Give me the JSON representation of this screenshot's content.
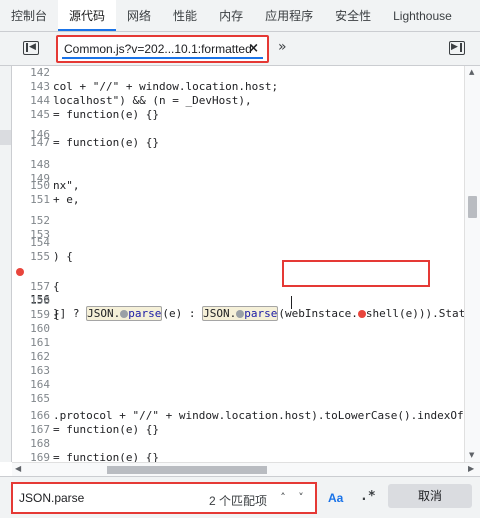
{
  "topbar": {
    "tabs": [
      {
        "label": "控制台"
      },
      {
        "label": "源代码"
      },
      {
        "label": "网络"
      },
      {
        "label": "性能"
      },
      {
        "label": "内存"
      },
      {
        "label": "应用程序"
      },
      {
        "label": "安全性"
      },
      {
        "label": "Lighthouse"
      }
    ],
    "active_index": 1
  },
  "file_tab": {
    "name": "Common.js?v=202...10.1:formatted",
    "close": "×",
    "more_tabs": "»"
  },
  "code": {
    "lines": [
      {
        "num": "142",
        "text": ""
      },
      {
        "num": "143",
        "text": "col + \"//\" + window.location.host;"
      },
      {
        "num": "144",
        "text": "localhost\") && (n = _DevHost),"
      },
      {
        "num": "145",
        "text": "= function(e) {}"
      },
      {
        "num": "146",
        "text": ""
      },
      {
        "num": "147",
        "text": "= function(e) {}"
      },
      {
        "num": "148",
        "text": ""
      },
      {
        "num": "149",
        "text": ""
      },
      {
        "num": "150",
        "text": "nx\","
      },
      {
        "num": "151",
        "text": "+ e,"
      },
      {
        "num": "152",
        "text": ""
      },
      {
        "num": "153",
        "text": ""
      },
      {
        "num": "154",
        "text": ""
      },
      {
        "num": "155",
        "text": ") {"
      },
      {
        "num": "156",
        "text": ""
      },
      {
        "num": "157",
        "text": "{"
      },
      {
        "num": "158",
        "text": ""
      },
      {
        "num": "159",
        "text": "{"
      },
      {
        "num": "160",
        "text": ""
      },
      {
        "num": "161",
        "text": ""
      },
      {
        "num": "162",
        "text": ""
      },
      {
        "num": "163",
        "text": ""
      },
      {
        "num": "164",
        "text": ""
      },
      {
        "num": "165",
        "text": ""
      },
      {
        "num": "166",
        "text": ".protocol + \"//\" + window.location.host).toLowerCase().indexOf("
      },
      {
        "num": "167",
        "text": "= function(e) {}"
      },
      {
        "num": "168",
        "text": ""
      },
      {
        "num": "169",
        "text": "= function(e) {}"
      }
    ],
    "breakpoint_line": {
      "prefix": "}] ? ",
      "json1": "JSON.",
      "parse1": "parse",
      "mid1": "(e) : ",
      "json2": "JSON.",
      "parse2": "parse",
      "open": "(",
      "call": "webInstace.",
      "shell": "shell(e)",
      "close": ")).Stat"
    }
  },
  "search": {
    "value": "JSON.parse",
    "match_count": "2 个匹配项",
    "prev": "˄",
    "next": "˅",
    "case_label": "Aa",
    "regex_label": ".*",
    "cancel_label": "取消"
  }
}
